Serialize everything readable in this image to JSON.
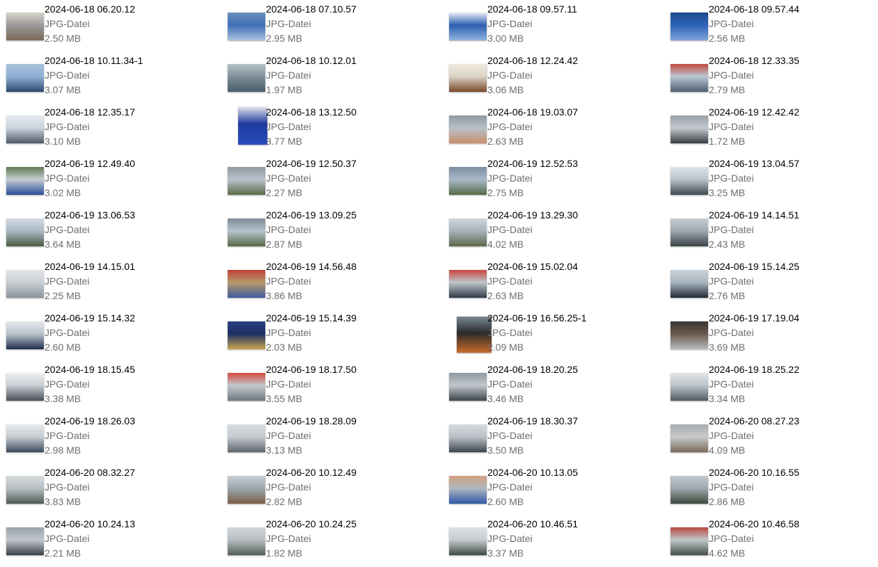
{
  "files": [
    {
      "name": "2024-06-18 06.20.12",
      "type": "JPG-Datei",
      "size": "2.50 MB",
      "thumb": [
        "#9a9a9a",
        "#7b6a58",
        "#d9d4c8"
      ]
    },
    {
      "name": "2024-06-18 07.10.57",
      "type": "JPG-Datei",
      "size": "2.95 MB",
      "thumb": [
        "#3e6fb7",
        "#a9c3e0",
        "#6b8fb8"
      ]
    },
    {
      "name": "2024-06-18 09.57.11",
      "type": "JPG-Datei",
      "size": "3.00 MB",
      "thumb": [
        "#2d5fb0",
        "#8fb2de",
        "#e8eef6"
      ]
    },
    {
      "name": "2024-06-18 09.57.44",
      "type": "JPG-Datei",
      "size": "2.56 MB",
      "thumb": [
        "#2b63b9",
        "#7ea5d8",
        "#1f4a8c"
      ]
    },
    {
      "name": "2024-06-18 10.11.34-1",
      "type": "JPG-Datei",
      "size": "3.07 MB",
      "thumb": [
        "#8fb0d6",
        "#2c4a6e",
        "#a7bfd8"
      ]
    },
    {
      "name": "2024-06-18 10.12.01",
      "type": "JPG-Datei",
      "size": "1.97 MB",
      "thumb": [
        "#7f909c",
        "#4a5c68",
        "#b6c2c8"
      ]
    },
    {
      "name": "2024-06-18 12.24.42",
      "type": "JPG-Datei",
      "size": "3.06 MB",
      "thumb": [
        "#dcd3c6",
        "#7a4a2a",
        "#efe9df"
      ]
    },
    {
      "name": "2024-06-18 12.33.35",
      "type": "JPG-Datei",
      "size": "2.79 MB",
      "thumb": [
        "#b9c7d6",
        "#4f5e6c",
        "#c14a3d"
      ]
    },
    {
      "name": "2024-06-18 12.35.17",
      "type": "JPG-Datei",
      "size": "3.10 MB",
      "thumb": [
        "#c9d4de",
        "#4e5a66",
        "#e6eaee"
      ]
    },
    {
      "name": "2024-06-18 13.12.50",
      "type": "JPG-Datei",
      "size": "3.77 MB",
      "thumb": [
        "#1f3a9c",
        "#2a4cbb",
        "#e8e8ee"
      ],
      "orient": "portrait"
    },
    {
      "name": "2024-06-18 19.03.07",
      "type": "JPG-Datei",
      "size": "2.63 MB",
      "thumb": [
        "#b7c0c7",
        "#c98f6e",
        "#8f9aa3"
      ]
    },
    {
      "name": "2024-06-19 12.42.42",
      "type": "JPG-Datei",
      "size": "1.72 MB",
      "thumb": [
        "#c2c8cd",
        "#3a3f44",
        "#9aa1a7"
      ]
    },
    {
      "name": "2024-06-19 12.49.40",
      "type": "JPG-Datei",
      "size": "3.02 MB",
      "thumb": [
        "#c5ccd2",
        "#2a4f9a",
        "#5f7a54"
      ]
    },
    {
      "name": "2024-06-19 12.50.37",
      "type": "JPG-Datei",
      "size": "2.27 MB",
      "thumb": [
        "#b9c2ca",
        "#5b6a4a",
        "#8d9aa4"
      ]
    },
    {
      "name": "2024-06-19 12.52.53",
      "type": "JPG-Datei",
      "size": "2.75 MB",
      "thumb": [
        "#a9b9c8",
        "#556b45",
        "#7d8f9f"
      ]
    },
    {
      "name": "2024-06-19 13.04.57",
      "type": "JPG-Datei",
      "size": "3.25 MB",
      "thumb": [
        "#b8c2cb",
        "#3e4a52",
        "#dfe4e8"
      ]
    },
    {
      "name": "2024-06-19 13.06.53",
      "type": "JPG-Datei",
      "size": "3.64 MB",
      "thumb": [
        "#aab8c6",
        "#4a5e44",
        "#d4dbe2"
      ]
    },
    {
      "name": "2024-06-19 13.09.25",
      "type": "JPG-Datei",
      "size": "2.87 MB",
      "thumb": [
        "#b6c2cd",
        "#566a48",
        "#7c8c98"
      ]
    },
    {
      "name": "2024-06-19 13.29.30",
      "type": "JPG-Datei",
      "size": "4.02 MB",
      "thumb": [
        "#a7b2bc",
        "#5c6a4a",
        "#d0d6db"
      ]
    },
    {
      "name": "2024-06-19 14.14.51",
      "type": "JPG-Datei",
      "size": "2.43 MB",
      "thumb": [
        "#9ea8b0",
        "#3c444b",
        "#c8ced3"
      ]
    },
    {
      "name": "2024-06-19 14.15.01",
      "type": "JPG-Datei",
      "size": "2.25 MB",
      "thumb": [
        "#c9ced3",
        "#8a949c",
        "#e4e7ea"
      ]
    },
    {
      "name": "2024-06-19 14.56.48",
      "type": "JPG-Datei",
      "size": "3.86 MB",
      "thumb": [
        "#b79a6a",
        "#3e5b9e",
        "#c33f3a"
      ]
    },
    {
      "name": "2024-06-19 15.02.04",
      "type": "JPG-Datei",
      "size": "2.63 MB",
      "thumb": [
        "#bfc6cc",
        "#2f3a46",
        "#c9463d"
      ]
    },
    {
      "name": "2024-06-19 15.14.25",
      "type": "JPG-Datei",
      "size": "2.76 MB",
      "thumb": [
        "#a8b4be",
        "#1f2a36",
        "#c9d2da"
      ]
    },
    {
      "name": "2024-06-19 15.14.32",
      "type": "JPG-Datei",
      "size": "2.60 MB",
      "thumb": [
        "#b8c3cc",
        "#1e2f4e",
        "#e4e8ec"
      ]
    },
    {
      "name": "2024-06-19 15.14.39",
      "type": "JPG-Datei",
      "size": "2.03 MB",
      "thumb": [
        "#1d2f66",
        "#c9a64a",
        "#2a3f80"
      ]
    },
    {
      "name": "2024-06-19 16.56.25-1",
      "type": "JPG-Datei",
      "size": "2.09 MB",
      "thumb": [
        "#2a2a2a",
        "#c96a2a",
        "#7a8a96"
      ],
      "orient": "portrait-sm"
    },
    {
      "name": "2024-06-19 17.19.04",
      "type": "JPG-Datei",
      "size": "3.69 MB",
      "thumb": [
        "#6a5a4e",
        "#b6bcc0",
        "#3a3430"
      ]
    },
    {
      "name": "2024-06-19 18.15.45",
      "type": "JPG-Datei",
      "size": "3.38 MB",
      "thumb": [
        "#c7cdd2",
        "#4a5058",
        "#eef0f2"
      ]
    },
    {
      "name": "2024-06-19 18.17.50",
      "type": "JPG-Datei",
      "size": "3.55 MB",
      "thumb": [
        "#c3c9ce",
        "#6f7880",
        "#d24a3e"
      ]
    },
    {
      "name": "2024-06-19 18.20.25",
      "type": "JPG-Datei",
      "size": "3.46 MB",
      "thumb": [
        "#c1c7cc",
        "#3e454b",
        "#8f989f"
      ]
    },
    {
      "name": "2024-06-19 18.25.22",
      "type": "JPG-Datei",
      "size": "3.34 MB",
      "thumb": [
        "#bcc3c9",
        "#535b62",
        "#e2e6e9"
      ]
    },
    {
      "name": "2024-06-19 18.26.03",
      "type": "JPG-Datei",
      "size": "2.98 MB",
      "thumb": [
        "#c6ccd1",
        "#3a4a5a",
        "#e8ebee"
      ]
    },
    {
      "name": "2024-06-19 18.28.09",
      "type": "JPG-Datei",
      "size": "3.13 MB",
      "thumb": [
        "#c4cacf",
        "#5e666d",
        "#d9dde0"
      ]
    },
    {
      "name": "2024-06-19 18.30.37",
      "type": "JPG-Datei",
      "size": "3.50 MB",
      "thumb": [
        "#b9c0c6",
        "#3f464d",
        "#d6dbdf"
      ]
    },
    {
      "name": "2024-06-20 08.27.23",
      "type": "JPG-Datei",
      "size": "4.09 MB",
      "thumb": [
        "#c7c9c9",
        "#7a6a5c",
        "#a7adb1"
      ]
    },
    {
      "name": "2024-06-20 08.32.27",
      "type": "JPG-Datei",
      "size": "3.83 MB",
      "thumb": [
        "#b8bfc4",
        "#4f5a52",
        "#d7dbde"
      ]
    },
    {
      "name": "2024-06-20 10.12.49",
      "type": "JPG-Datei",
      "size": "2.82 MB",
      "thumb": [
        "#9aa6ae",
        "#7a5e4a",
        "#c7cdd1"
      ]
    },
    {
      "name": "2024-06-20 10.13.05",
      "type": "JPG-Datei",
      "size": "2.60 MB",
      "thumb": [
        "#aeb8c0",
        "#3158a8",
        "#d2a080"
      ]
    },
    {
      "name": "2024-06-20 10.16.55",
      "type": "JPG-Datei",
      "size": "2.86 MB",
      "thumb": [
        "#9ea7ae",
        "#3d4a3e",
        "#c2c8cc"
      ]
    },
    {
      "name": "2024-06-20 10.24.13",
      "type": "JPG-Datei",
      "size": "2.21 MB",
      "thumb": [
        "#c1c7cc",
        "#3a4148",
        "#9aa2a8"
      ]
    },
    {
      "name": "2024-06-20 10.24.25",
      "type": "JPG-Datei",
      "size": "1.82 MB",
      "thumb": [
        "#b7bec3",
        "#56605a",
        "#d4d8db"
      ]
    },
    {
      "name": "2024-06-20 10.46.51",
      "type": "JPG-Datei",
      "size": "3.37 MB",
      "thumb": [
        "#c6cbcf",
        "#3f4a44",
        "#e0e3e5"
      ]
    },
    {
      "name": "2024-06-20 10.46.58",
      "type": "JPG-Datei",
      "size": "4.62 MB",
      "thumb": [
        "#c0c6cb",
        "#44504a",
        "#b94a3e"
      ]
    }
  ]
}
